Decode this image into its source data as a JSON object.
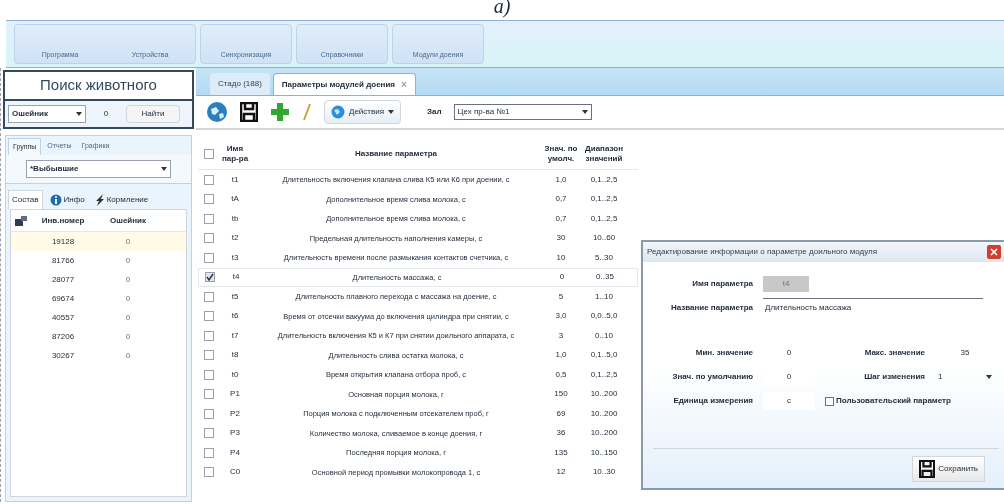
{
  "caption": "а)",
  "ribbon": {
    "groups": [
      [
        "Программа",
        "Устройства"
      ],
      [
        "Синхронизация"
      ],
      [
        "Справочники"
      ],
      [
        "Модули доения"
      ]
    ]
  },
  "animal_search": {
    "title": "Поиск животного",
    "field_dropdown": "Ошейник",
    "value": "0",
    "button": "Найти"
  },
  "left_tabs": [
    {
      "label": "Группы",
      "selected": true
    },
    {
      "label": "Отчеты",
      "selected": false
    },
    {
      "label": "Графики",
      "selected": false
    }
  ],
  "group_dropdown": "*Выбывшие",
  "sub_tabs": [
    {
      "label": "Состав",
      "selected": true
    },
    {
      "label": "Инфо",
      "selected": false
    },
    {
      "label": "Кормление",
      "selected": false
    }
  ],
  "animals": {
    "columns": [
      "Инв.номер",
      "Ошейник"
    ],
    "rows": [
      {
        "cells": [
          "19128",
          "0"
        ],
        "selected": true
      },
      {
        "cells": [
          "81766",
          "0"
        ],
        "selected": false
      },
      {
        "cells": [
          "28077",
          "0"
        ],
        "selected": false
      },
      {
        "cells": [
          "69674",
          "0"
        ],
        "selected": false
      },
      {
        "cells": [
          "40557",
          "0"
        ],
        "selected": false
      },
      {
        "cells": [
          "87206",
          "0"
        ],
        "selected": false
      },
      {
        "cells": [
          "30267",
          "0"
        ],
        "selected": false
      }
    ]
  },
  "doc_tabs": [
    {
      "label": "Стадо (188)",
      "selected": false
    },
    {
      "label": "Параметры модулей доения",
      "selected": true,
      "close": "×"
    }
  ],
  "toolbar": {
    "actions": "Действия",
    "hall_label": "Зал",
    "hall": "Цех пр-ва №1"
  },
  "params": {
    "all_checked": false,
    "columns": [
      "Имя пар-ра",
      "Название параметра",
      "Знач. по умолч.",
      "Диапазон значений"
    ],
    "rows": [
      {
        "checked": false,
        "cells": [
          "t1",
          "Длительность включения клапана слива К5 или К6 при доении, с",
          "1,0",
          "0,1..2,5"
        ]
      },
      {
        "checked": false,
        "cells": [
          "tA",
          "Дополнительное время слива молока, с",
          "0,7",
          "0,1..2,5"
        ]
      },
      {
        "checked": false,
        "cells": [
          "tb",
          "Дополнительное время слива молока, с",
          "0,7",
          "0,1..2,5"
        ]
      },
      {
        "checked": false,
        "cells": [
          "t2",
          "Предельная длительность наполнения камеры, с",
          "30",
          "10..60"
        ]
      },
      {
        "checked": false,
        "cells": [
          "t3",
          "Длительность времени после размыкания контактов счетчика, с",
          "10",
          "5..30"
        ]
      },
      {
        "checked": true,
        "cells": [
          "t4",
          "Длительность массажа, с",
          "0",
          "0..35"
        ]
      },
      {
        "checked": false,
        "cells": [
          "t5",
          "Длительность плавного перехода с массажа на доение, с",
          "5",
          "1..10"
        ]
      },
      {
        "checked": false,
        "cells": [
          "t6",
          "Время от отсечки вакуума до включения цилиндра при снятии, с",
          "3,0",
          "0,0..5,0"
        ]
      },
      {
        "checked": false,
        "cells": [
          "t7",
          "Длительность включения К5 и К7 при снятии доильного аппарата, с",
          "3",
          "0..10"
        ]
      },
      {
        "checked": false,
        "cells": [
          "t8",
          "Длительность слива остатка молока, с",
          "1,0",
          "0,1..5,0"
        ]
      },
      {
        "checked": false,
        "cells": [
          "t0",
          "Время открытия клапана отбора проб, с",
          "0,5",
          "0,1..2,5"
        ]
      },
      {
        "checked": false,
        "cells": [
          "P1",
          "Основная порция молока, г",
          "150",
          "10..200"
        ]
      },
      {
        "checked": false,
        "cells": [
          "P2",
          "Порция молока с подключенным отсекателем проб, г",
          "69",
          "10..200"
        ]
      },
      {
        "checked": false,
        "cells": [
          "P3",
          "Количество молока, сливаемое в конце доения, г",
          "36",
          "10..200"
        ]
      },
      {
        "checked": false,
        "cells": [
          "P4",
          "Последняя порция молока, г",
          "135",
          "10..150"
        ]
      },
      {
        "checked": false,
        "cells": [
          "C0",
          "Основной период промывки молокопровода 1, с",
          "12",
          "10..30"
        ]
      }
    ]
  },
  "dialog": {
    "title": "Редактирование информации о параметре доильного модуля",
    "name_label": "Имя параметра",
    "name": "t4",
    "title_label": "Название параметра",
    "param_title": "Длительность массажа",
    "min_label": "Мин. значение",
    "min": "0",
    "max_label": "Макс. значение",
    "max": "35",
    "default_label": "Знач. по умолчанию",
    "default": "0",
    "step_label": "Шаг изменения",
    "step": "1",
    "unit_label": "Единица измерения",
    "unit": "с",
    "custom_label": "Пользовательский параметр",
    "custom": false,
    "save": "Сохранить"
  }
}
